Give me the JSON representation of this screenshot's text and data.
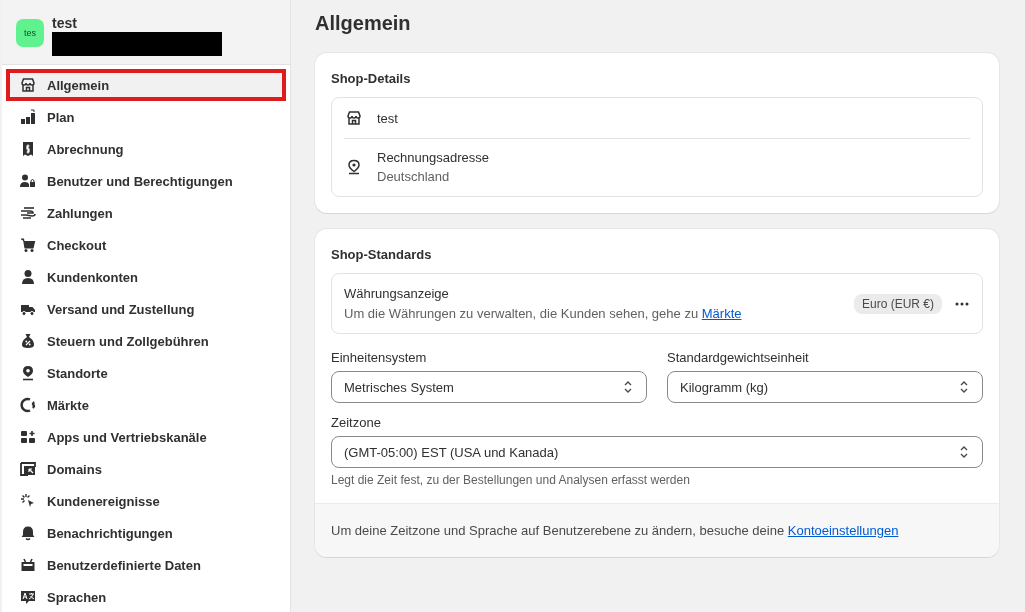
{
  "store": {
    "avatar": "tes",
    "name": "test"
  },
  "sidebar": {
    "items": [
      {
        "label": "Allgemein",
        "selected": true,
        "highlighted": true
      },
      {
        "label": "Plan",
        "selected": false,
        "highlighted": false
      },
      {
        "label": "Abrechnung",
        "selected": false,
        "highlighted": false
      },
      {
        "label": "Benutzer und Berechtigungen",
        "selected": false,
        "highlighted": false
      },
      {
        "label": "Zahlungen",
        "selected": false,
        "highlighted": false
      },
      {
        "label": "Checkout",
        "selected": false,
        "highlighted": false
      },
      {
        "label": "Kundenkonten",
        "selected": false,
        "highlighted": false
      },
      {
        "label": "Versand und Zustellung",
        "selected": false,
        "highlighted": false
      },
      {
        "label": "Steuern und Zollgebühren",
        "selected": false,
        "highlighted": false
      },
      {
        "label": "Standorte",
        "selected": false,
        "highlighted": false
      },
      {
        "label": "Märkte",
        "selected": false,
        "highlighted": false
      },
      {
        "label": "Apps und Vertriebskanäle",
        "selected": false,
        "highlighted": false
      },
      {
        "label": "Domains",
        "selected": false,
        "highlighted": false
      },
      {
        "label": "Kundenereignisse",
        "selected": false,
        "highlighted": false
      },
      {
        "label": "Benachrichtigungen",
        "selected": false,
        "highlighted": false
      },
      {
        "label": "Benutzerdefinierte Daten",
        "selected": false,
        "highlighted": false
      },
      {
        "label": "Sprachen",
        "selected": false,
        "highlighted": false
      }
    ]
  },
  "page_title": "Allgemein",
  "shop_details": {
    "title": "Shop-Details",
    "name": "test",
    "address_label": "Rechnungsadresse",
    "address_value": "Deutschland"
  },
  "shop_standards": {
    "title": "Shop-Standards",
    "currency": {
      "title": "Währungsanzeige",
      "text": "Um die Währungen zu verwalten, die Kunden sehen, gehe zu",
      "link": "Märkte",
      "badge": "Euro (EUR €)"
    },
    "unit_system": {
      "label": "Einheitensystem",
      "value": "Metrisches System"
    },
    "weight_unit": {
      "label": "Standardgewichtseinheit",
      "value": "Kilogramm (kg)"
    },
    "timezone": {
      "label": "Zeitzone",
      "value": "(GMT-05:00) EST (USA und Kanada)",
      "help": "Legt die Zeit fest, zu der Bestellungen und Analysen erfasst werden"
    },
    "footer": {
      "text": "Um deine Zeitzone und Sprache auf Benutzerebene zu ändern, besuche deine",
      "link": "Kontoeinstellungen"
    }
  }
}
